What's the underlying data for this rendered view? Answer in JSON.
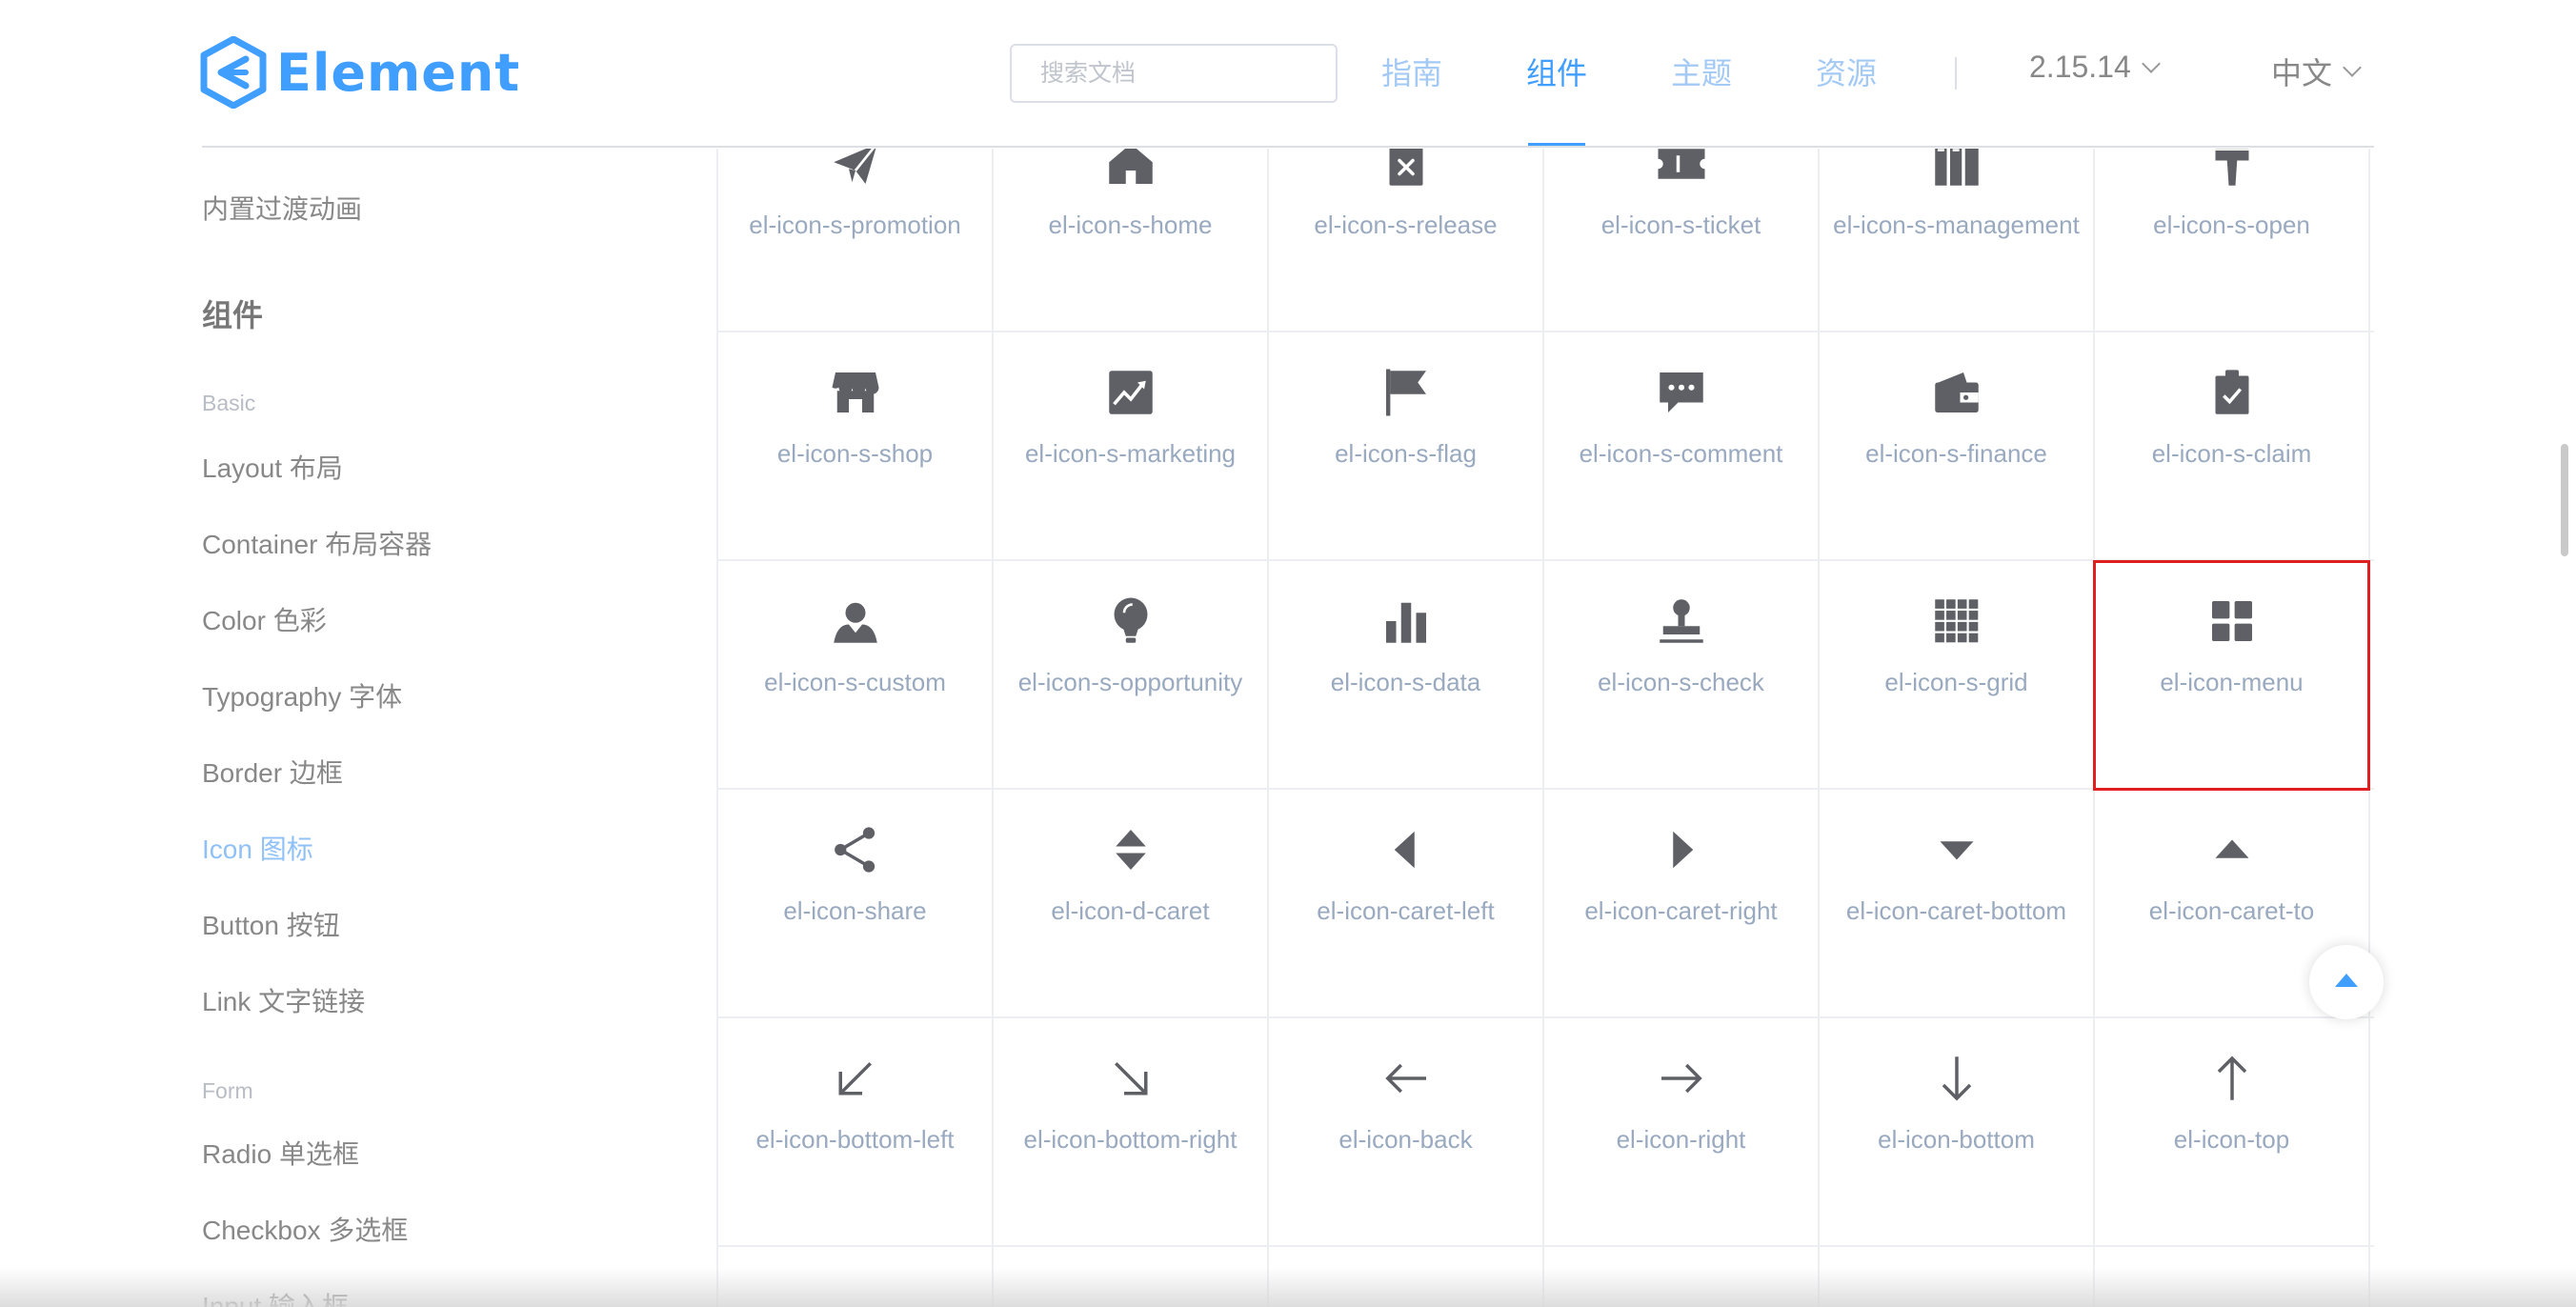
{
  "header": {
    "logo_text": "Element",
    "search_placeholder": "搜索文档",
    "nav": [
      {
        "label": "指南"
      },
      {
        "label": "组件"
      },
      {
        "label": "主题"
      },
      {
        "label": "资源"
      }
    ],
    "version": "2.15.14",
    "language": "中文",
    "accent_color": "#409eff"
  },
  "sidebar": {
    "top_item": "内置过渡动画",
    "group_title": "组件",
    "basic_label": "Basic",
    "basic_items": [
      {
        "label": "Layout 布局"
      },
      {
        "label": "Container 布局容器"
      },
      {
        "label": "Color 色彩"
      },
      {
        "label": "Typography 字体"
      },
      {
        "label": "Border 边框"
      },
      {
        "label": "Icon 图标"
      },
      {
        "label": "Button 按钮"
      },
      {
        "label": "Link 文字链接"
      }
    ],
    "form_label": "Form",
    "form_items": [
      {
        "label": "Radio 单选框"
      },
      {
        "label": "Checkbox 多选框"
      },
      {
        "label": "Input 输入框"
      }
    ],
    "active_item": "Icon 图标"
  },
  "icons": [
    [
      {
        "name": "el-icon-s-promotion",
        "icon": "paper-plane-icon"
      },
      {
        "name": "el-icon-s-home",
        "icon": "home-icon"
      },
      {
        "name": "el-icon-s-release",
        "icon": "clipboard-x-icon"
      },
      {
        "name": "el-icon-s-ticket",
        "icon": "ticket-icon"
      },
      {
        "name": "el-icon-s-management",
        "icon": "books-icon"
      },
      {
        "name": "el-icon-s-open",
        "icon": "brush-icon"
      }
    ],
    [
      {
        "name": "el-icon-s-shop",
        "icon": "shop-icon"
      },
      {
        "name": "el-icon-s-marketing",
        "icon": "trend-chart-icon"
      },
      {
        "name": "el-icon-s-flag",
        "icon": "flag-icon"
      },
      {
        "name": "el-icon-s-comment",
        "icon": "comment-icon"
      },
      {
        "name": "el-icon-s-finance",
        "icon": "wallet-icon"
      },
      {
        "name": "el-icon-s-claim",
        "icon": "clipboard-check-icon"
      }
    ],
    [
      {
        "name": "el-icon-s-custom",
        "icon": "person-icon"
      },
      {
        "name": "el-icon-s-opportunity",
        "icon": "lightbulb-icon"
      },
      {
        "name": "el-icon-s-data",
        "icon": "bar-chart-icon"
      },
      {
        "name": "el-icon-s-check",
        "icon": "stamp-icon"
      },
      {
        "name": "el-icon-s-grid",
        "icon": "grid-icon"
      },
      {
        "name": "el-icon-menu",
        "icon": "menu-icon"
      }
    ],
    [
      {
        "name": "el-icon-share",
        "icon": "share-icon"
      },
      {
        "name": "el-icon-d-caret",
        "icon": "double-caret-icon"
      },
      {
        "name": "el-icon-caret-left",
        "icon": "caret-left-icon"
      },
      {
        "name": "el-icon-caret-right",
        "icon": "caret-right-icon"
      },
      {
        "name": "el-icon-caret-bottom",
        "icon": "caret-bottom-icon"
      },
      {
        "name": "el-icon-caret-to",
        "icon": "caret-top-icon"
      }
    ],
    [
      {
        "name": "el-icon-bottom-left",
        "icon": "arrow-bottom-left-icon"
      },
      {
        "name": "el-icon-bottom-right",
        "icon": "arrow-bottom-right-icon"
      },
      {
        "name": "el-icon-back",
        "icon": "arrow-left-icon"
      },
      {
        "name": "el-icon-right",
        "icon": "arrow-right-icon"
      },
      {
        "name": "el-icon-bottom",
        "icon": "arrow-down-icon"
      },
      {
        "name": "el-icon-top",
        "icon": "arrow-up-icon"
      }
    ]
  ],
  "selected_icon": "el-icon-menu",
  "highlight_color": "#e02020",
  "icon_color": "#5e6066",
  "label_color": "#99a9bf"
}
